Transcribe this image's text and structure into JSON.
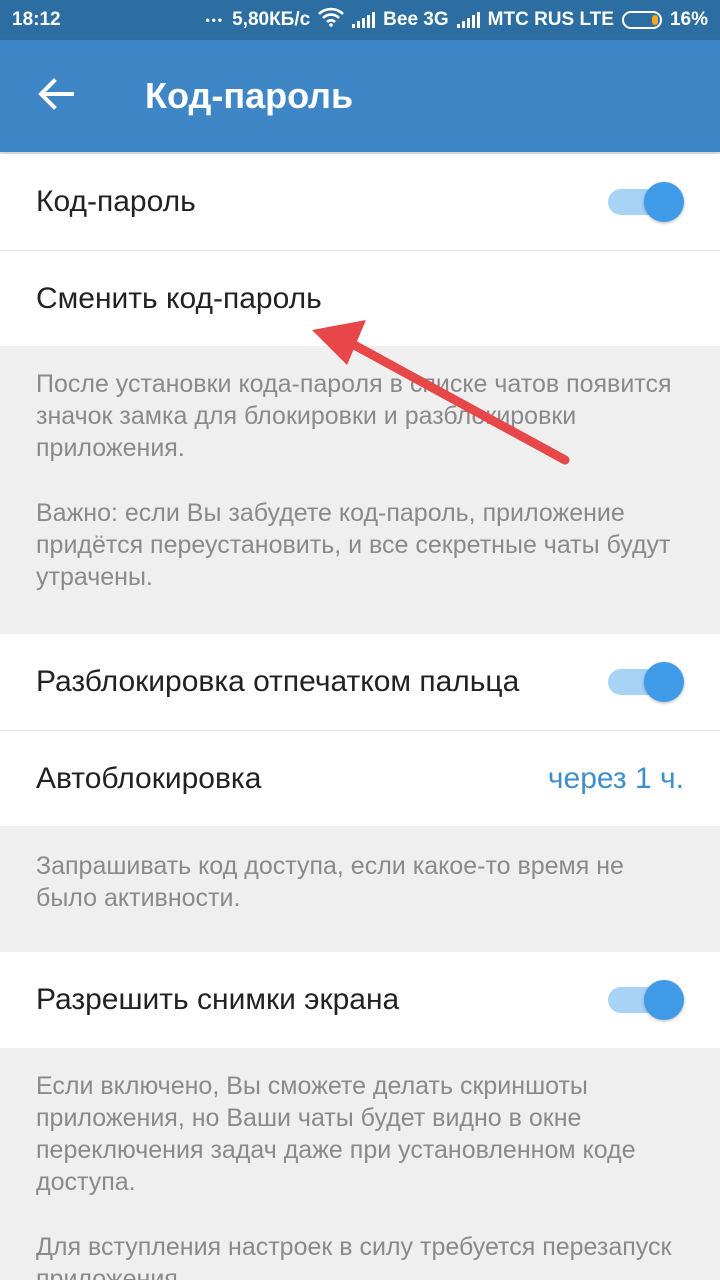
{
  "status_bar": {
    "time": "18:12",
    "dots": "•••",
    "net_speed": "5,80КБ/с",
    "carrier1": "Bee 3G",
    "carrier2": "MTC RUS LTE",
    "battery_percent": "16%",
    "battery_level": 0.16
  },
  "app_bar": {
    "title": "Код-пароль",
    "back_icon": "arrow-back-icon"
  },
  "settings": {
    "passcode": {
      "label": "Код-пароль",
      "enabled": true
    },
    "change_passcode": {
      "label": "Сменить код-пароль"
    },
    "passcode_info": [
      "После установки кода-пароля в списке чатов появится значок замка для блокировки и разблокировки приложения.",
      "Важно: если Вы забудете код-пароль, приложение придётся переустановить, и все секретные чаты будут утрачены."
    ],
    "fingerprint": {
      "label": "Разблокировка отпечатком пальца",
      "enabled": true
    },
    "autolock": {
      "label": "Автоблокировка",
      "value": "через 1 ч."
    },
    "autolock_info": "Запрашивать код доступа, если какое-то время не было активности.",
    "screenshots": {
      "label": "Разрешить снимки экрана",
      "enabled": true
    },
    "screenshots_info": [
      "Если включено, Вы сможете делать скриншоты приложения, но Ваши чаты будет видно в окне переключения задач даже при установленном коде доступа.",
      "Для вступления настроек в силу требуется перезапуск приложения."
    ]
  },
  "colors": {
    "status_bar": "#2c6ea1",
    "app_bar": "#3f86c6",
    "accent": "#3d8fca",
    "toggle_thumb": "#3f9be7",
    "toggle_track": "#a7d3f6",
    "annotation_arrow": "#e8474a"
  }
}
